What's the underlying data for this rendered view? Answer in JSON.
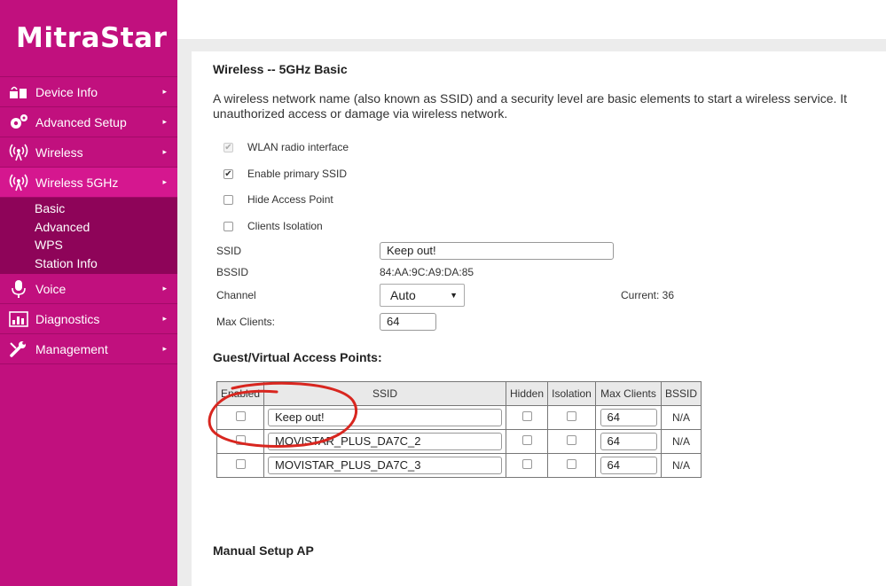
{
  "brand": {
    "logo_text": "MitraStar"
  },
  "sidebar": {
    "items": [
      {
        "label": "Device Info",
        "icon": "device-info-icon"
      },
      {
        "label": "Advanced Setup",
        "icon": "gears-icon"
      },
      {
        "label": "Wireless",
        "icon": "wireless-icon"
      },
      {
        "label": "Wireless 5GHz",
        "icon": "wireless-icon"
      },
      {
        "label": "Voice",
        "icon": "microphone-icon"
      },
      {
        "label": "Diagnostics",
        "icon": "chart-icon"
      },
      {
        "label": "Management",
        "icon": "wrench-icon"
      }
    ],
    "submenu": [
      "Basic",
      "Advanced",
      "WPS",
      "Station Info"
    ],
    "arrow": "▸"
  },
  "page": {
    "title": "Wireless -- 5GHz Basic",
    "description_line1": "A wireless network name (also known as SSID) and a security level are basic elements to start a wireless service. It",
    "description_line2": "unauthorized access or damage via wireless network.",
    "options": {
      "wlan_radio": "WLAN radio interface",
      "enable_primary": "Enable primary SSID",
      "hide_ap": "Hide Access Point",
      "clients_isolation": "Clients Isolation"
    },
    "ssid_label": "SSID",
    "ssid_value": "Keep out!",
    "bssid_label": "BSSID",
    "bssid_value": "84:AA:9C:A9:DA:85",
    "channel_label": "Channel",
    "channel_value": "Auto",
    "current_label": "Current: 36",
    "max_clients_label": "Max Clients:",
    "max_clients_value": "64",
    "guest_title": "Guest/Virtual Access Points:",
    "manual_title": "Manual Setup AP"
  },
  "guest_table": {
    "headers": [
      "Enabled",
      "SSID",
      "Hidden",
      "Isolation",
      "Max Clients",
      "BSSID"
    ],
    "rows": [
      {
        "ssid": "Keep out!",
        "max_clients": "64",
        "bssid": "N/A"
      },
      {
        "ssid": "MOVISTAR_PLUS_DA7C_2",
        "max_clients": "64",
        "bssid": "N/A"
      },
      {
        "ssid": "MOVISTAR_PLUS_DA7C_3",
        "max_clients": "64",
        "bssid": "N/A"
      }
    ]
  },
  "colors": {
    "sidebar": "#c1107e",
    "submenu": "#8e0459",
    "annotation": "#d8261f"
  }
}
